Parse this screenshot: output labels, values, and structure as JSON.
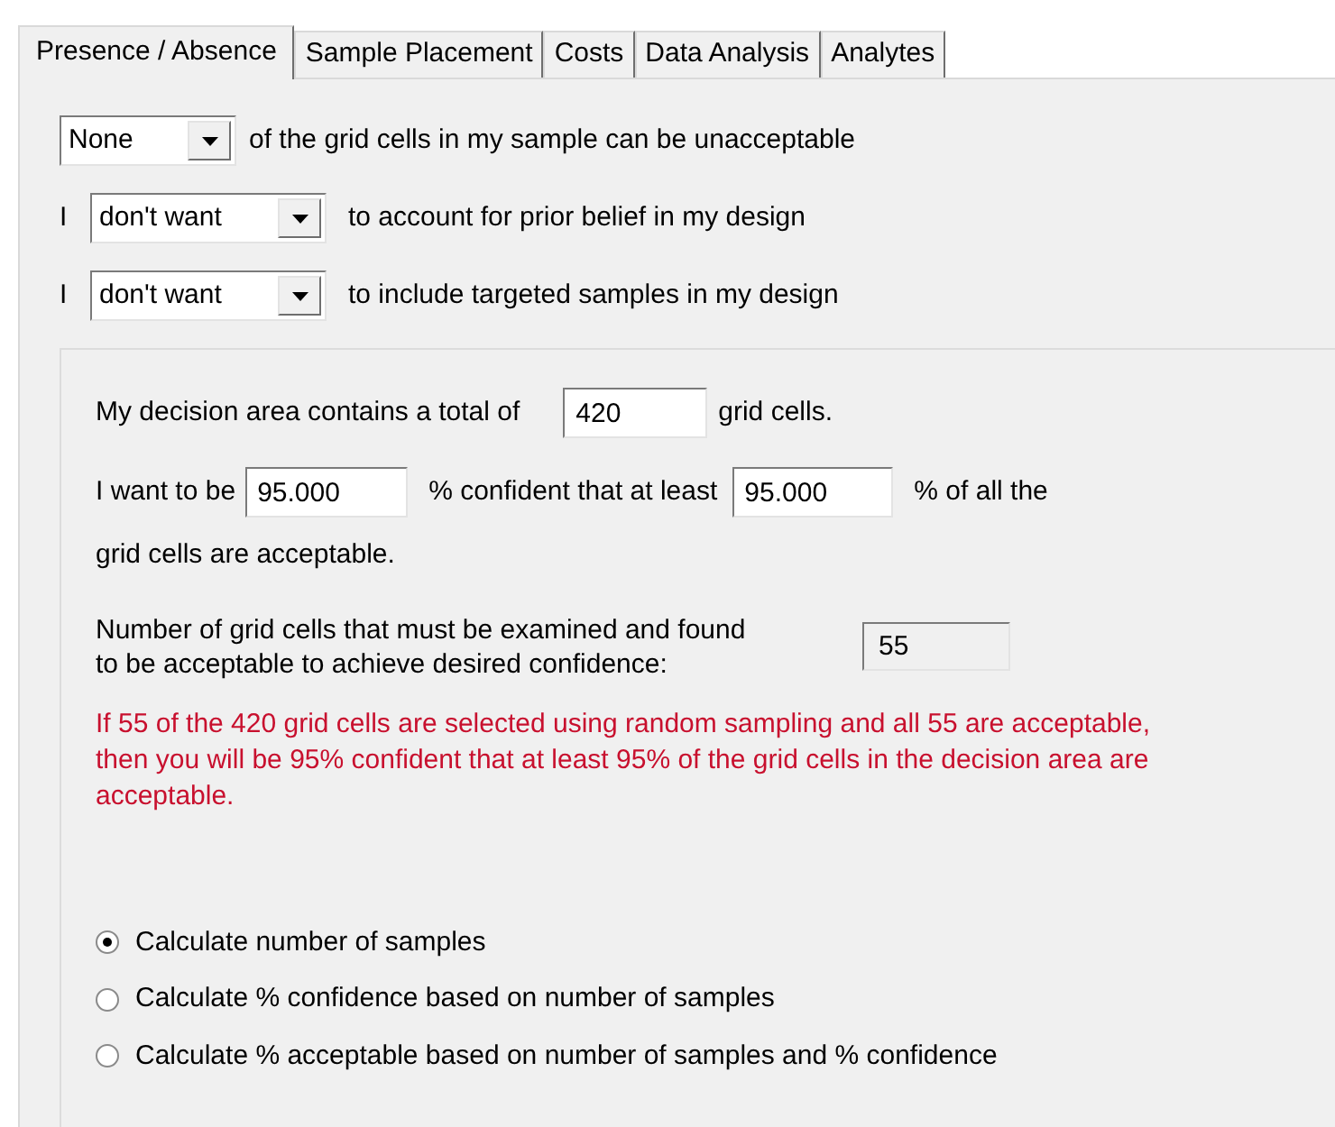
{
  "tabs": [
    {
      "label": "Presence / Absence",
      "selected": true
    },
    {
      "label": "Sample Placement",
      "selected": false
    },
    {
      "label": "Costs",
      "selected": false
    },
    {
      "label": "Data Analysis",
      "selected": false
    },
    {
      "label": "Analytes",
      "selected": false
    }
  ],
  "options": [
    {
      "value": "None",
      "text": "of the grid cells in my sample can be unacceptable"
    },
    {
      "prefix": "I",
      "value": "don't want",
      "text": "to account for prior belief in my design"
    },
    {
      "prefix": "I",
      "value": "don't want",
      "text": "to include targeted samples in my design"
    }
  ],
  "decision_area": {
    "label": "My decision area contains a total of",
    "value": "420",
    "suffix": "grid cells."
  },
  "confidence": {
    "label": "I want to be",
    "confidence_value": "95.000",
    "middle": "% confident that at least",
    "acceptable_value": "95.000",
    "suffix": "% of all the",
    "continuation": "grid cells are acceptable."
  },
  "result": {
    "label": "Number of grid cells that must be examined and found\nto be acceptable to achieve desired confidence:",
    "value": "55"
  },
  "message": "If 55 of the 420 grid cells are selected using random sampling and all 55 are acceptable, then you will be 95% confident that at least 95% of the grid cells in the decision area are acceptable.",
  "modes": [
    {
      "label": "Calculate number of samples",
      "selected": true
    },
    {
      "label": "Calculate % confidence based on number of samples",
      "selected": false
    },
    {
      "label": "Calculate % acceptable based on number of samples and % confidence",
      "selected": false
    }
  ]
}
